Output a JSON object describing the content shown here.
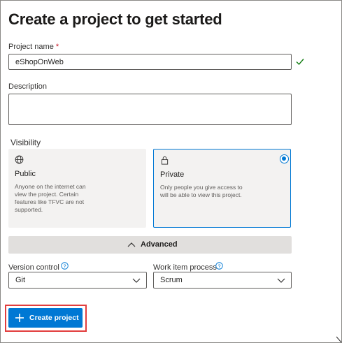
{
  "page": {
    "title": "Create a project to get started"
  },
  "project_name": {
    "label": "Project name",
    "required_mark": "*",
    "value": "eShopOnWeb"
  },
  "description": {
    "label": "Description",
    "value": ""
  },
  "visibility": {
    "label": "Visibility",
    "options": [
      {
        "title": "Public",
        "description": "Anyone on the internet can view the project. Certain features like TFVC are not supported.",
        "icon": "globe-icon",
        "selected": false
      },
      {
        "title": "Private",
        "description": "Only people you give access to will be able to view this project.",
        "icon": "lock-icon",
        "selected": true
      }
    ]
  },
  "advanced": {
    "label": "Advanced",
    "icon": "chevron-up-icon"
  },
  "version_control": {
    "label": "Version control",
    "value": "Git"
  },
  "work_item_process": {
    "label": "Work item process",
    "value": "Scrum"
  },
  "create_button": {
    "label": "Create project",
    "icon": "plus-icon"
  },
  "colors": {
    "accent": "#0078d4",
    "highlight_box": "#e23d3d",
    "valid_check": "#107c10"
  }
}
